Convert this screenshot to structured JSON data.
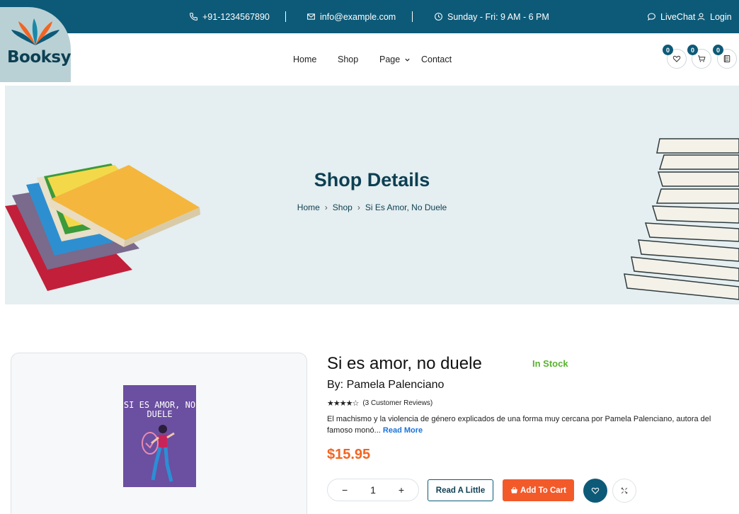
{
  "topbar": {
    "phone": "+91-1234567890",
    "email": "info@example.com",
    "hours": "Sunday - Fri: 9 AM - 6 PM",
    "livechat": "LiveChat",
    "login": "Login"
  },
  "brand": {
    "name": "Booksy"
  },
  "nav": {
    "items": [
      "Home",
      "Shop",
      "Page",
      "Contact"
    ],
    "wishlist_count": "0",
    "cart_count": "0",
    "compare_count": "0"
  },
  "banner": {
    "title": "Shop Details",
    "breadcrumb": [
      "Home",
      "Shop",
      "Si Es Amor, No Duele"
    ]
  },
  "product": {
    "title": "Si es amor, no duele",
    "stock": "In Stock",
    "byline": "By: Pamela Palenciano",
    "rating": 4,
    "rating_max": 5,
    "reviews": "(3 Customer Reviews)",
    "description": "El machismo y la violencia de género explicados de una forma muy cercana por Pamela Palenciano, autora del famoso monó...",
    "read_more": "Read More",
    "price": "$15.95",
    "quantity": "1",
    "read_label": "Read A Little",
    "cart_label": "Add To Cart",
    "cover_title": "SI ES AMOR, NO DUELE"
  },
  "colors": {
    "primary": "#0d5a78",
    "accent": "#f35a2a",
    "stock": "#58b32e",
    "banner_bg": "#e5eef0"
  }
}
